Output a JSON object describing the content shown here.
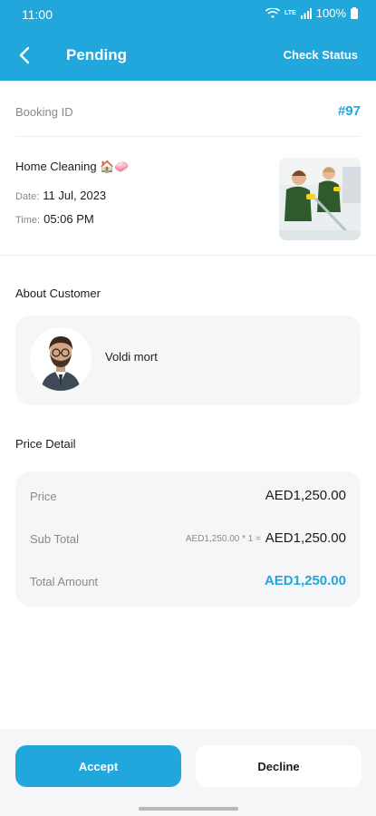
{
  "status_bar": {
    "time": "11:00",
    "battery": "100%",
    "network": "LTE"
  },
  "header": {
    "title": "Pending",
    "action_label": "Check Status"
  },
  "booking": {
    "id_label": "Booking ID",
    "id_value": "#97"
  },
  "service": {
    "name": "Home Cleaning 🏠🧼",
    "date_label": "Date:",
    "date_value": "11 Jul, 2023",
    "time_label": "Time:",
    "time_value": "05:06 PM"
  },
  "customer": {
    "section_title": "About Customer",
    "name": "Voldi mort"
  },
  "price": {
    "section_title": "Price Detail",
    "price_label": "Price",
    "price_value": "AED1,250.00",
    "subtotal_label": "Sub Total",
    "subtotal_calc": "AED1,250.00 * 1 =",
    "subtotal_value": "AED1,250.00",
    "total_label": "Total Amount",
    "total_value": "AED1,250.00"
  },
  "actions": {
    "accept_label": "Accept",
    "decline_label": "Decline"
  },
  "colors": {
    "accent": "#22a7dc",
    "card_bg": "#f5f6f8"
  },
  "icons": [
    "wifi-icon",
    "signal-icon",
    "battery-icon",
    "back-arrow-icon"
  ]
}
